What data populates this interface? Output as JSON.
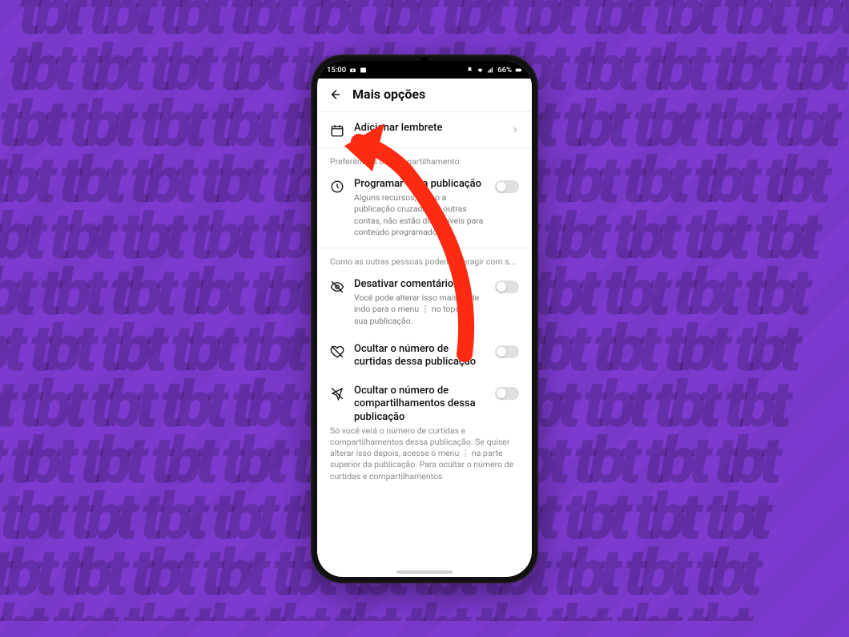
{
  "annotation": {
    "arrow_color": "#ff2a12"
  },
  "statusbar": {
    "time": "15:00",
    "battery_text": "66%",
    "left_icons": [
      "camera-icon",
      "image-icon"
    ],
    "right_icons": [
      "silent-icon",
      "wifi-icon",
      "signal-icon",
      "battery-icon"
    ]
  },
  "header": {
    "title": "Mais opções"
  },
  "rows": {
    "add_reminder": {
      "title": "Adicionar lembrete"
    },
    "section_share": "Preferências de compartilhamento",
    "schedule": {
      "title": "Programar essa publicação",
      "sub": "Alguns recursos, como a publicação cruzada em outras contas, não estão disponíveis para conteúdo programado."
    },
    "section_interact": "Como as outras pessoas podem interagir com s...",
    "disable_comments": {
      "title": "Desativar comentários",
      "sub": "Você pode alterar isso mais tarde indo para o menu ⋮ no topo da sua publicação."
    },
    "hide_likes": {
      "title": "Ocultar o número de curtidas dessa publicação"
    },
    "hide_shares": {
      "title": "Ocultar o número de compartilhamentos dessa publicação"
    },
    "footer_note": "Só você verá o número de curtidas e compartilhamentos dessa publicação. Se quiser alterar isso depois, acesse o menu ⋮ na parte superior da publicação. Para ocultar o número de curtidas e compartilhamentos"
  }
}
